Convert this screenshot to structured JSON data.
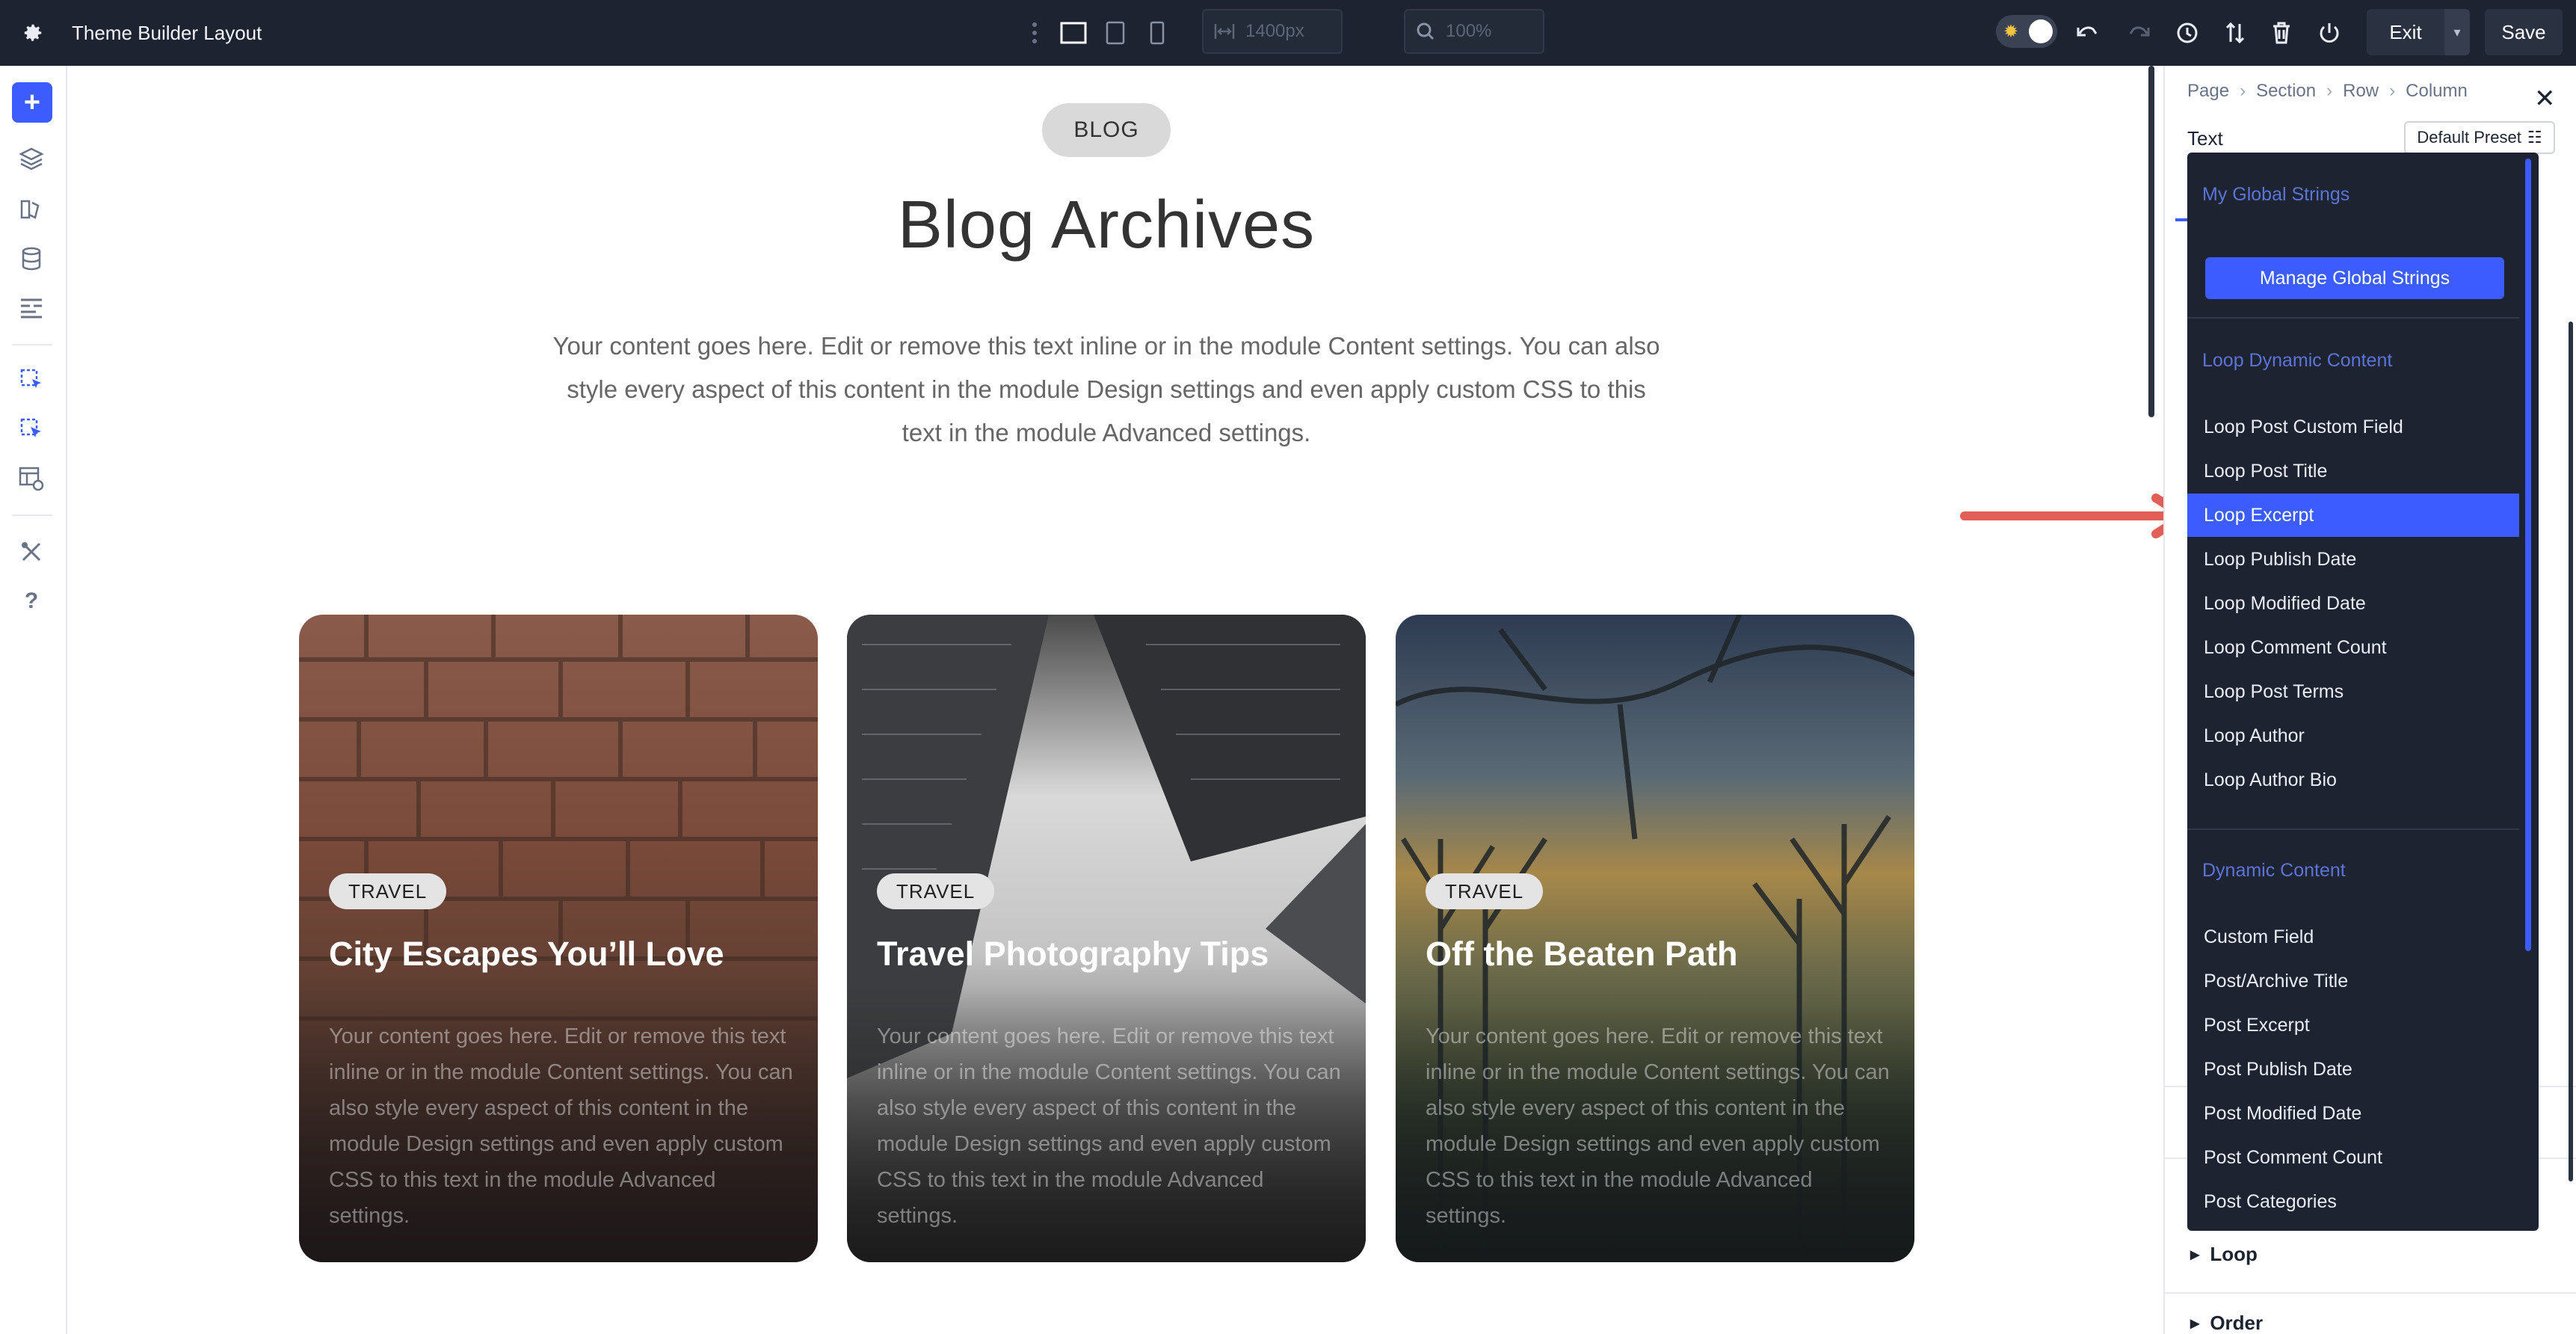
{
  "topbar": {
    "title": "Theme Builder Layout",
    "width_value": "1400px",
    "zoom_value": "100%",
    "exit_label": "Exit",
    "save_label": "Save"
  },
  "canvas": {
    "badge": "BLOG",
    "heading": "Blog Archives",
    "intro": "Your content goes here. Edit or remove this text inline or in the module Content settings. You can also style every aspect of this content in the module Design settings and even apply custom CSS to this text in the module Advanced settings.",
    "cards": [
      {
        "tag": "TRAVEL",
        "title": "City Escapes You’ll Love",
        "body": "Your content goes here. Edit or remove this text inline or in the module Content settings. You can also style every aspect of this content in the module Design settings and even apply custom CSS to this text in the module Advanced settings."
      },
      {
        "tag": "TRAVEL",
        "title": "Travel Photography Tips",
        "body": "Your content goes here. Edit or remove this text inline or in the module Content settings. You can also style every aspect of this content in the module Design settings and even apply custom CSS to this text in the module Advanced settings."
      },
      {
        "tag": "TRAVEL",
        "title": "Off the Beaten Path",
        "body": "Your content goes here. Edit or remove this text inline or in the module Content settings. You can also style every aspect of this content in the module Design settings and even apply custom CSS to this text in the module Advanced settings."
      }
    ]
  },
  "panel": {
    "breadcrumb": [
      "Page",
      "Section",
      "Row",
      "Column"
    ],
    "title": "Text",
    "preset_label": "Default Preset",
    "sections": [
      "Loop",
      "Order"
    ]
  },
  "dropdown": {
    "global_heading": "My Global Strings",
    "manage_label": "Manage Global Strings",
    "loop_heading": "Loop Dynamic Content",
    "loop_items": [
      "Loop Post Custom Field",
      "Loop Post Title",
      "Loop Excerpt",
      "Loop Publish Date",
      "Loop Modified Date",
      "Loop Comment Count",
      "Loop Post Terms",
      "Loop Author",
      "Loop Author Bio"
    ],
    "active_item": "Loop Excerpt",
    "dynamic_heading": "Dynamic Content",
    "dynamic_items": [
      "Custom Field",
      "Post/Archive Title",
      "Post Excerpt",
      "Post Publish Date",
      "Post Modified Date",
      "Post Comment Count",
      "Post Categories"
    ]
  },
  "colors": {
    "accent": "#3d5cff",
    "topbar": "#1d2330",
    "arrow": "#e25f57"
  }
}
